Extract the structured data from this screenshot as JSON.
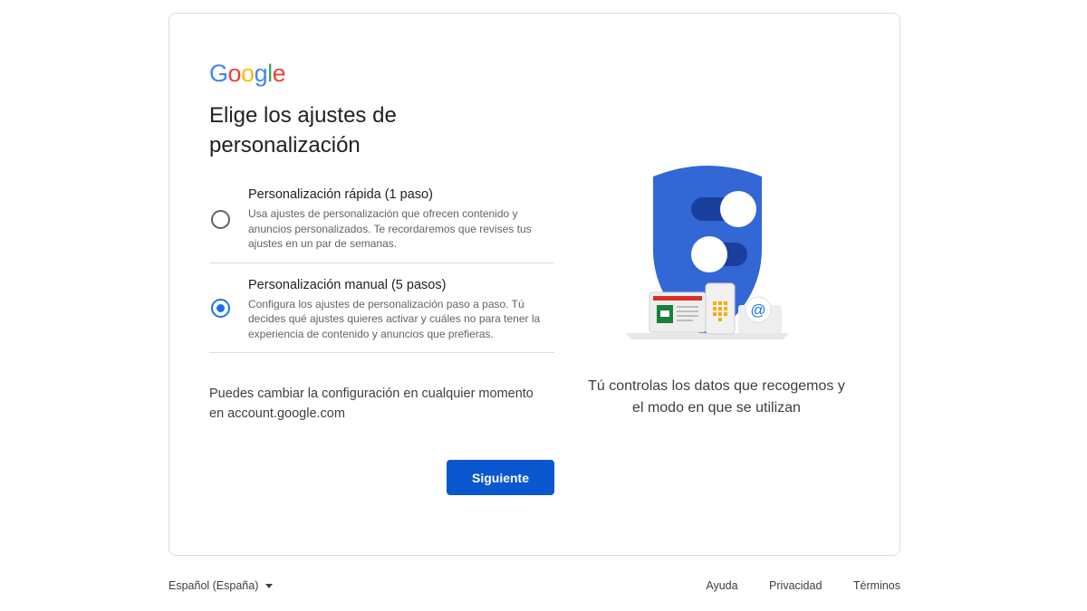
{
  "logo": {
    "text": "Google"
  },
  "page": {
    "title_line1": "Elige los ajustes de",
    "title_line2": "personalización"
  },
  "options": [
    {
      "title": "Personalización rápida (1 paso)",
      "description": "Usa ajustes de personalización que ofrecen contenido y anuncios personalizados. Te recordaremos que revises tus ajustes en un par de semanas.",
      "selected": false
    },
    {
      "title": "Personalización manual (5 pasos)",
      "description": "Configura los ajustes de personalización paso a paso. Tú decides qué ajustes quieres activar y cuáles no para tener la experiencia de contenido y anuncios que prefieras.",
      "selected": true
    }
  ],
  "note": {
    "line1": "Puedes cambiar la configuración en cualquier momento",
    "line2": "en account.google.com"
  },
  "buttons": {
    "next": "Siguiente"
  },
  "illustration": {
    "caption": "Tú controlas los datos que recogemos y el modo en que se utilizan",
    "icon": "shield-toggles-devices-icon"
  },
  "footer": {
    "language": "Español (España)",
    "links": [
      "Ayuda",
      "Privacidad",
      "Términos"
    ]
  },
  "colors": {
    "accent": "#1a73e8",
    "button": "#0b57d0",
    "shield": "#3367d6"
  }
}
